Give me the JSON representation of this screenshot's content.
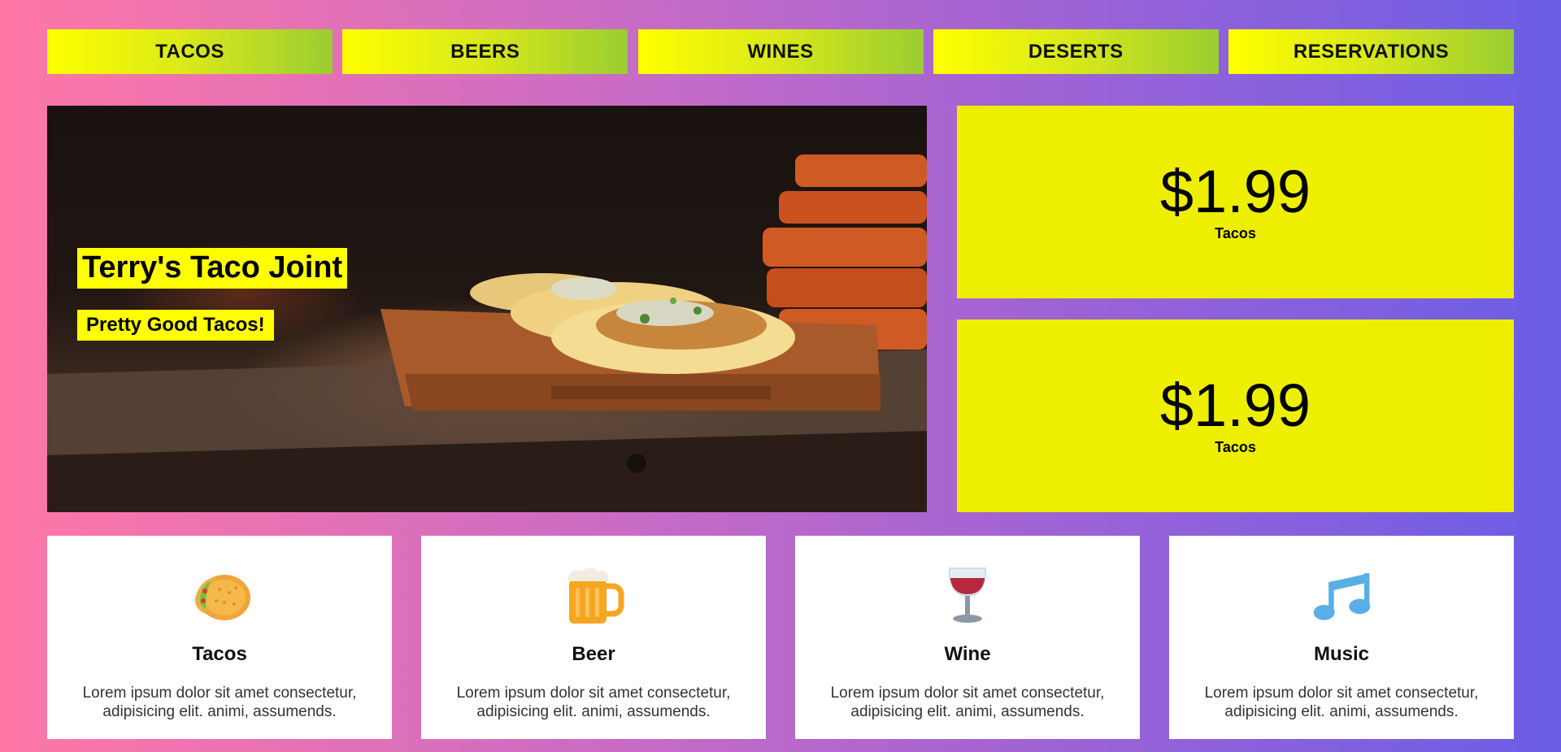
{
  "nav": {
    "items": [
      {
        "label": "TACOS"
      },
      {
        "label": "BEERS"
      },
      {
        "label": "WINES"
      },
      {
        "label": "DESERTS"
      },
      {
        "label": "RESERVATIONS"
      }
    ]
  },
  "hero": {
    "title": "Terry's Taco Joint",
    "subtitle": "Pretty Good Tacos!"
  },
  "prices": [
    {
      "value": "$1.99",
      "label": "Tacos"
    },
    {
      "value": "$1.99",
      "label": "Tacos"
    }
  ],
  "features": [
    {
      "icon": "taco-icon",
      "title": "Tacos",
      "text": "Lorem ipsum dolor sit amet consectetur, adipisicing elit. animi, assumends."
    },
    {
      "icon": "beer-icon",
      "title": "Beer",
      "text": "Lorem ipsum dolor sit amet consectetur, adipisicing elit. animi, assumends."
    },
    {
      "icon": "wine-glass-icon",
      "title": "Wine",
      "text": "Lorem ipsum dolor sit amet consectetur, adipisicing elit. animi, assumends."
    },
    {
      "icon": "music-note-icon",
      "title": "Music",
      "text": "Lorem ipsum dolor sit amet consectetur, adipisicing elit. animi, assumends."
    }
  ],
  "colors": {
    "nav_gradient_start": "#ffff00",
    "nav_gradient_end": "#9acd32",
    "price_card_bg": "#eeee00",
    "page_gradient_start": "#ff77a6",
    "page_gradient_end": "#6b5ee6"
  }
}
